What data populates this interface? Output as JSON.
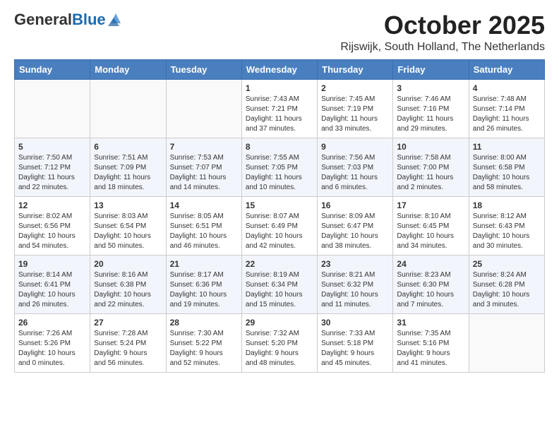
{
  "logo": {
    "general": "General",
    "blue": "Blue"
  },
  "title": "October 2025",
  "location": "Rijswijk, South Holland, The Netherlands",
  "days_of_week": [
    "Sunday",
    "Monday",
    "Tuesday",
    "Wednesday",
    "Thursday",
    "Friday",
    "Saturday"
  ],
  "weeks": [
    [
      {
        "day": "",
        "info": ""
      },
      {
        "day": "",
        "info": ""
      },
      {
        "day": "",
        "info": ""
      },
      {
        "day": "1",
        "info": "Sunrise: 7:43 AM\nSunset: 7:21 PM\nDaylight: 11 hours\nand 37 minutes."
      },
      {
        "day": "2",
        "info": "Sunrise: 7:45 AM\nSunset: 7:19 PM\nDaylight: 11 hours\nand 33 minutes."
      },
      {
        "day": "3",
        "info": "Sunrise: 7:46 AM\nSunset: 7:16 PM\nDaylight: 11 hours\nand 29 minutes."
      },
      {
        "day": "4",
        "info": "Sunrise: 7:48 AM\nSunset: 7:14 PM\nDaylight: 11 hours\nand 26 minutes."
      }
    ],
    [
      {
        "day": "5",
        "info": "Sunrise: 7:50 AM\nSunset: 7:12 PM\nDaylight: 11 hours\nand 22 minutes."
      },
      {
        "day": "6",
        "info": "Sunrise: 7:51 AM\nSunset: 7:09 PM\nDaylight: 11 hours\nand 18 minutes."
      },
      {
        "day": "7",
        "info": "Sunrise: 7:53 AM\nSunset: 7:07 PM\nDaylight: 11 hours\nand 14 minutes."
      },
      {
        "day": "8",
        "info": "Sunrise: 7:55 AM\nSunset: 7:05 PM\nDaylight: 11 hours\nand 10 minutes."
      },
      {
        "day": "9",
        "info": "Sunrise: 7:56 AM\nSunset: 7:03 PM\nDaylight: 11 hours\nand 6 minutes."
      },
      {
        "day": "10",
        "info": "Sunrise: 7:58 AM\nSunset: 7:00 PM\nDaylight: 11 hours\nand 2 minutes."
      },
      {
        "day": "11",
        "info": "Sunrise: 8:00 AM\nSunset: 6:58 PM\nDaylight: 10 hours\nand 58 minutes."
      }
    ],
    [
      {
        "day": "12",
        "info": "Sunrise: 8:02 AM\nSunset: 6:56 PM\nDaylight: 10 hours\nand 54 minutes."
      },
      {
        "day": "13",
        "info": "Sunrise: 8:03 AM\nSunset: 6:54 PM\nDaylight: 10 hours\nand 50 minutes."
      },
      {
        "day": "14",
        "info": "Sunrise: 8:05 AM\nSunset: 6:51 PM\nDaylight: 10 hours\nand 46 minutes."
      },
      {
        "day": "15",
        "info": "Sunrise: 8:07 AM\nSunset: 6:49 PM\nDaylight: 10 hours\nand 42 minutes."
      },
      {
        "day": "16",
        "info": "Sunrise: 8:09 AM\nSunset: 6:47 PM\nDaylight: 10 hours\nand 38 minutes."
      },
      {
        "day": "17",
        "info": "Sunrise: 8:10 AM\nSunset: 6:45 PM\nDaylight: 10 hours\nand 34 minutes."
      },
      {
        "day": "18",
        "info": "Sunrise: 8:12 AM\nSunset: 6:43 PM\nDaylight: 10 hours\nand 30 minutes."
      }
    ],
    [
      {
        "day": "19",
        "info": "Sunrise: 8:14 AM\nSunset: 6:41 PM\nDaylight: 10 hours\nand 26 minutes."
      },
      {
        "day": "20",
        "info": "Sunrise: 8:16 AM\nSunset: 6:38 PM\nDaylight: 10 hours\nand 22 minutes."
      },
      {
        "day": "21",
        "info": "Sunrise: 8:17 AM\nSunset: 6:36 PM\nDaylight: 10 hours\nand 19 minutes."
      },
      {
        "day": "22",
        "info": "Sunrise: 8:19 AM\nSunset: 6:34 PM\nDaylight: 10 hours\nand 15 minutes."
      },
      {
        "day": "23",
        "info": "Sunrise: 8:21 AM\nSunset: 6:32 PM\nDaylight: 10 hours\nand 11 minutes."
      },
      {
        "day": "24",
        "info": "Sunrise: 8:23 AM\nSunset: 6:30 PM\nDaylight: 10 hours\nand 7 minutes."
      },
      {
        "day": "25",
        "info": "Sunrise: 8:24 AM\nSunset: 6:28 PM\nDaylight: 10 hours\nand 3 minutes."
      }
    ],
    [
      {
        "day": "26",
        "info": "Sunrise: 7:26 AM\nSunset: 5:26 PM\nDaylight: 10 hours\nand 0 minutes."
      },
      {
        "day": "27",
        "info": "Sunrise: 7:28 AM\nSunset: 5:24 PM\nDaylight: 9 hours\nand 56 minutes."
      },
      {
        "day": "28",
        "info": "Sunrise: 7:30 AM\nSunset: 5:22 PM\nDaylight: 9 hours\nand 52 minutes."
      },
      {
        "day": "29",
        "info": "Sunrise: 7:32 AM\nSunset: 5:20 PM\nDaylight: 9 hours\nand 48 minutes."
      },
      {
        "day": "30",
        "info": "Sunrise: 7:33 AM\nSunset: 5:18 PM\nDaylight: 9 hours\nand 45 minutes."
      },
      {
        "day": "31",
        "info": "Sunrise: 7:35 AM\nSunset: 5:16 PM\nDaylight: 9 hours\nand 41 minutes."
      },
      {
        "day": "",
        "info": ""
      }
    ]
  ]
}
